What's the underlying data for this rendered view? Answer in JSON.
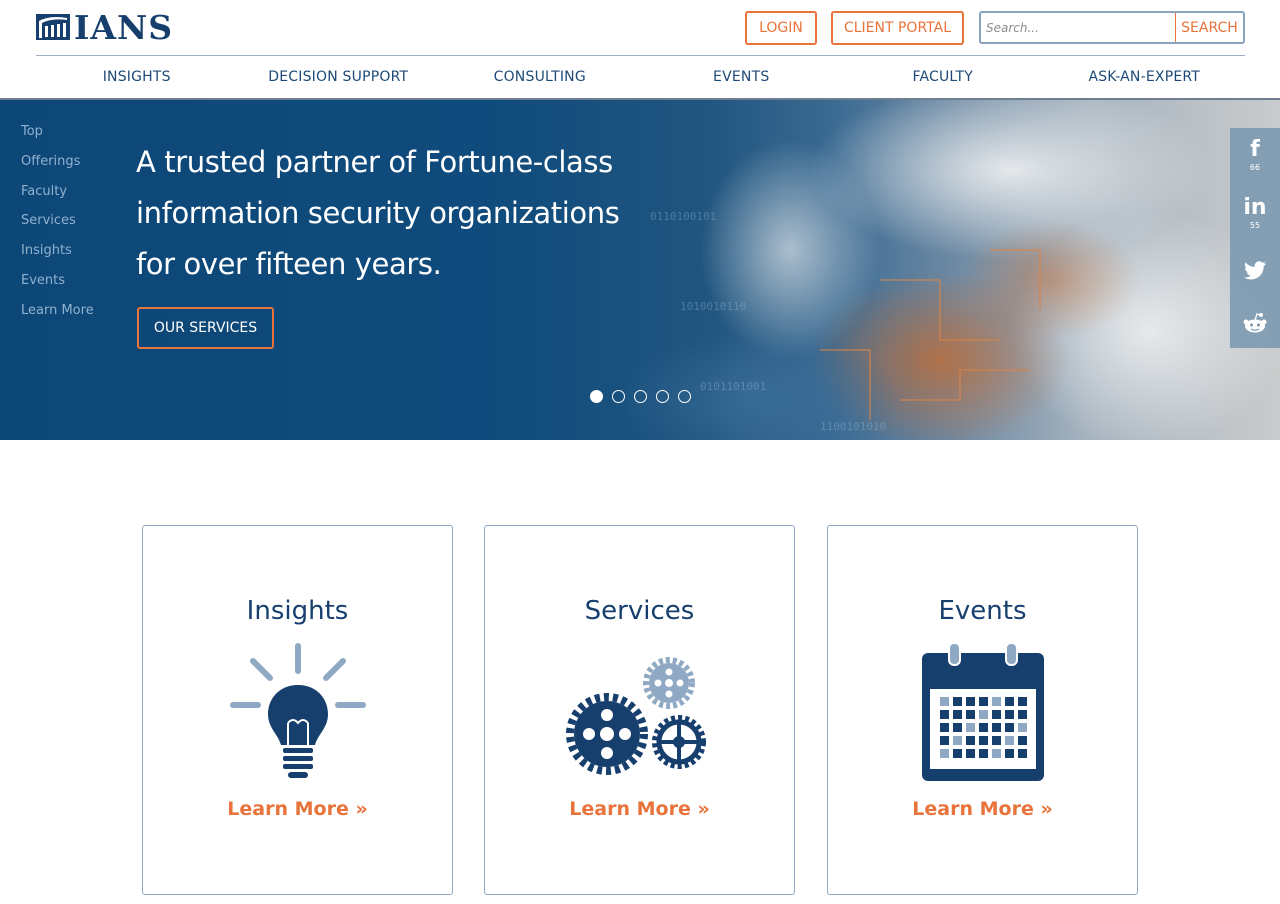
{
  "brand": {
    "name": "IANS",
    "accent_orange": "#e8733b",
    "primary_navy": "#173f6e"
  },
  "header": {
    "login_label": "LOGIN",
    "client_portal_label": "CLIENT PORTAL",
    "search_placeholder": "Search...",
    "search_button_label": "SEARCH"
  },
  "nav": {
    "items": [
      {
        "label": "INSIGHTS"
      },
      {
        "label": "DECISION SUPPORT"
      },
      {
        "label": "CONSULTING"
      },
      {
        "label": "EVENTS"
      },
      {
        "label": "FACULTY"
      },
      {
        "label": "ASK-AN-EXPERT"
      }
    ]
  },
  "hero": {
    "side_nav": [
      "Top",
      "Offerings",
      "Faculty",
      "Services",
      "Insights",
      "Events",
      "Learn More"
    ],
    "headline_lines": [
      "A trusted partner of Fortune-class",
      "information security organizations",
      "for over fifteen years."
    ],
    "cta_label": "OUR SERVICES",
    "slides_total": 5,
    "active_slide": 1
  },
  "share": {
    "items": [
      {
        "icon": "facebook-icon",
        "glyph": "f",
        "count": "66"
      },
      {
        "icon": "linkedin-icon",
        "glyph": "in",
        "count": "55"
      },
      {
        "icon": "twitter-icon",
        "glyph": "",
        "count": ""
      },
      {
        "icon": "reddit-icon",
        "glyph": "",
        "count": ""
      }
    ]
  },
  "cards": [
    {
      "title": "Insights",
      "icon": "lightbulb-icon",
      "link": "Learn More »"
    },
    {
      "title": "Services",
      "icon": "gears-icon",
      "link": "Learn More »"
    },
    {
      "title": "Events",
      "icon": "calendar-icon",
      "link": "Learn More »"
    }
  ]
}
